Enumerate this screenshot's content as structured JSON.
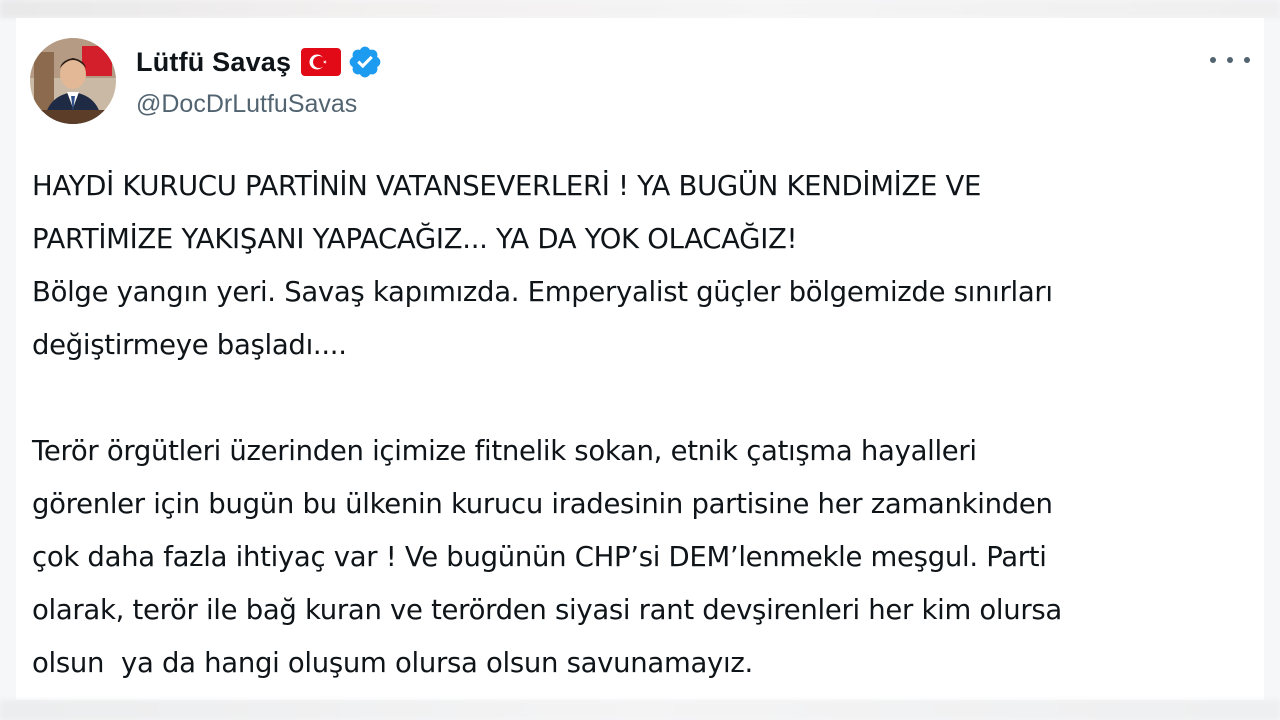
{
  "author": {
    "name": "Lütfü Savaş",
    "handle": "@DocDrLutfuSavas",
    "flag_icon": "turkish-flag-icon",
    "verified_icon": "verified-badge-icon",
    "verified_color": "#1d9bf0"
  },
  "menu": {
    "icon": "more-options-icon"
  },
  "post": {
    "line1": "HAYDİ KURUCU PARTİNİN VATANSEVERLERİ ! YA BUGÜN KENDİMİZE VE",
    "line2": "PARTİMİZE YAKIŞANI YAPACAĞIZ... YA DA YOK OLACAĞIZ!",
    "line3": "Bölge yangın yeri. Savaş kapımızda. Emperyalist güçler bölgemizde sınırları",
    "line4": "değiştirmeye başladı....",
    "line5": "Terör örgütleri üzerinden içimize fitnelik sokan, etnik çatışma hayalleri",
    "line6": "görenler için bugün bu ülkenin kurucu iradesinin partisine her zamankinden",
    "line7": "çok daha fazla ihtiyaç var ! Ve bugünün CHP’si DEM’lenmekle meşgul. Parti",
    "line8": "olarak, terör ile bağ kuran ve terörden siyasi rant devşirenleri her kim olursa",
    "line9": "olsun  ya da hangi oluşum olursa olsun savunamayız."
  },
  "colors": {
    "text": "#0f1419",
    "secondary": "#536471",
    "flag_red": "#e30a17"
  }
}
